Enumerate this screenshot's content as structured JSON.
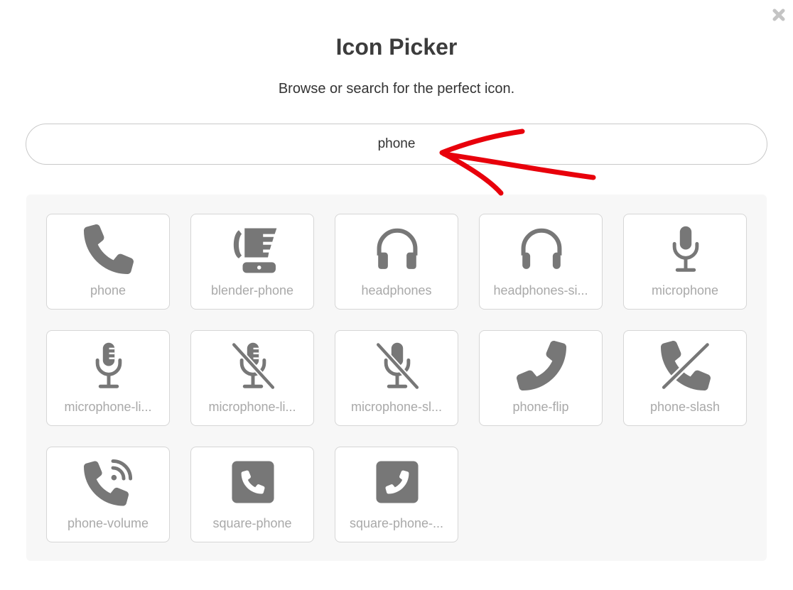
{
  "dialog": {
    "title": "Icon Picker",
    "subtitle": "Browse or search for the perfect icon.",
    "close_icon": "close-icon"
  },
  "search": {
    "value": "phone"
  },
  "colors": {
    "icon": "#777777",
    "label": "#a9a9a9",
    "annotation": "#e8000b"
  },
  "icons": [
    {
      "name": "phone",
      "label": "phone"
    },
    {
      "name": "blender-phone",
      "label": "blender-phone"
    },
    {
      "name": "headphones",
      "label": "headphones"
    },
    {
      "name": "headphones-simple",
      "label": "headphones-si..."
    },
    {
      "name": "microphone",
      "label": "microphone"
    },
    {
      "name": "microphone-lines",
      "label": "microphone-li..."
    },
    {
      "name": "microphone-lines-slash",
      "label": "microphone-li..."
    },
    {
      "name": "microphone-slash",
      "label": "microphone-sl..."
    },
    {
      "name": "phone-flip",
      "label": "phone-flip"
    },
    {
      "name": "phone-slash",
      "label": "phone-slash"
    },
    {
      "name": "phone-volume",
      "label": "phone-volume"
    },
    {
      "name": "square-phone",
      "label": "square-phone"
    },
    {
      "name": "square-phone-flip",
      "label": "square-phone-..."
    }
  ]
}
